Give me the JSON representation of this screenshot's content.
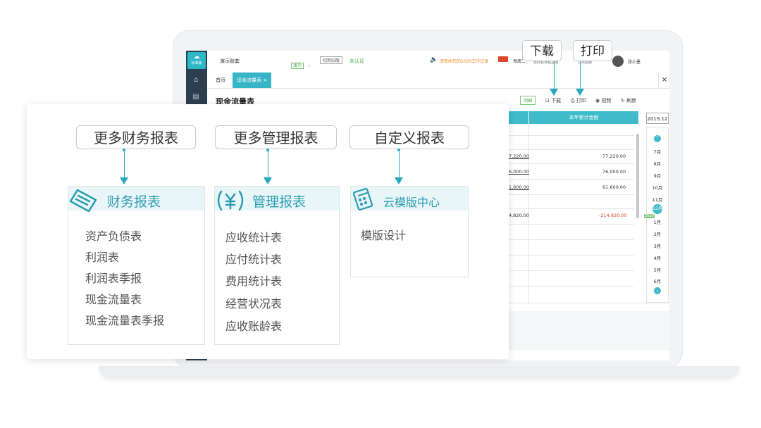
{
  "app": {
    "logo_label": "标准版",
    "account_name": "演示账套",
    "demo_tag": "演示",
    "switch_button": "切到旧版",
    "cert_status": "未认证",
    "notice": "请查收您的2020工作记录",
    "promo_text": "每周二",
    "promo_text2": "轻财税课程直播",
    "service_text": "在线客服",
    "username": "张小墨"
  },
  "tabs": [
    {
      "label": "首页"
    },
    {
      "label": "现金流量表 ×"
    }
  ],
  "close_label": "×",
  "page": {
    "title": "现金流量表",
    "toolbar": {
      "mingxi": "明细",
      "download": "下载",
      "print": "打印",
      "video": "视频",
      "refresh": "刷新"
    },
    "column_header": "本年累计金额",
    "rows_left": [
      "7,220.00",
      "6,000.00",
      "1,600.00",
      "4,820.00"
    ],
    "rows_right": [
      "77,220.00",
      "76,000.00",
      "61,600.00",
      "-214,820.00"
    ]
  },
  "period": {
    "current": "2019.12",
    "months": [
      "7月",
      "8月",
      "9月",
      "10月",
      "11月",
      "12月",
      "1月",
      "2月",
      "3月",
      "4月",
      "5月",
      "6月"
    ],
    "year_badge": "2020"
  },
  "callouts": {
    "download": "下载",
    "print": "打印"
  },
  "overlay": {
    "pills": [
      "更多财务报表",
      "更多管理报表",
      "自定义报表"
    ],
    "cards": [
      {
        "title": "财务报表",
        "items": [
          "资产负债表",
          "利润表",
          "利润表季报",
          "现金流量表",
          "现金流量表季报"
        ]
      },
      {
        "title": "管理报表",
        "items": [
          "应收统计表",
          "应付统计表",
          "费用统计表",
          "经营状况表",
          "应收账龄表"
        ]
      },
      {
        "title": "云模版中心",
        "items": [
          "模版设计"
        ]
      }
    ]
  },
  "colors": {
    "accent": "#37b5c6",
    "sidebar": "#2c3e50",
    "negative": "#e0452c"
  }
}
